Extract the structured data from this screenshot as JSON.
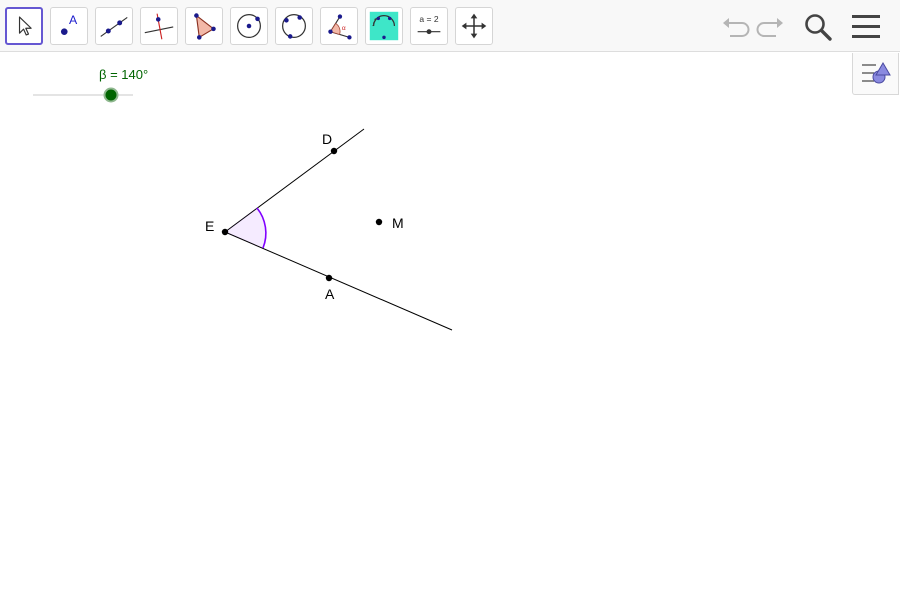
{
  "toolbar": {
    "tools": [
      {
        "name": "move-tool",
        "icon": "arrow-cursor-icon",
        "selected": true
      },
      {
        "name": "point-tool",
        "icon": "point-icon",
        "glyph": "A"
      },
      {
        "name": "line-tool",
        "icon": "line-through-two-points-icon"
      },
      {
        "name": "perpendicular-line-tool",
        "icon": "perpendicular-line-icon"
      },
      {
        "name": "polygon-tool",
        "icon": "polygon-icon"
      },
      {
        "name": "circle-tool",
        "icon": "circle-center-point-icon"
      },
      {
        "name": "circle-three-points-tool",
        "icon": "circle-three-points-icon"
      },
      {
        "name": "angle-tool",
        "icon": "angle-icon"
      },
      {
        "name": "reflect-tool",
        "icon": "reflect-about-line-icon"
      },
      {
        "name": "slider-tool",
        "icon": "slider-icon",
        "glyph": "a = 2"
      },
      {
        "name": "move-graphics-view-tool",
        "icon": "move-graphics-view-icon"
      }
    ],
    "undo_icon": "undo-icon",
    "redo_icon": "redo-icon",
    "search_icon": "search-icon",
    "menu_icon": "hamburger-menu-icon",
    "style_bar_icon": "style-bar-toggle-icon",
    "selected_color": "#6557d2"
  },
  "slider": {
    "label": "β = 140°",
    "value_deg": 140,
    "color": "#006400"
  },
  "construction": {
    "points": [
      {
        "id": "E",
        "label": "E"
      },
      {
        "id": "D",
        "label": "D"
      },
      {
        "id": "A",
        "label": "A"
      },
      {
        "id": "M",
        "label": "M"
      }
    ],
    "rays": [
      "ED",
      "EA"
    ],
    "angle_arc_color": "#8000ff"
  }
}
